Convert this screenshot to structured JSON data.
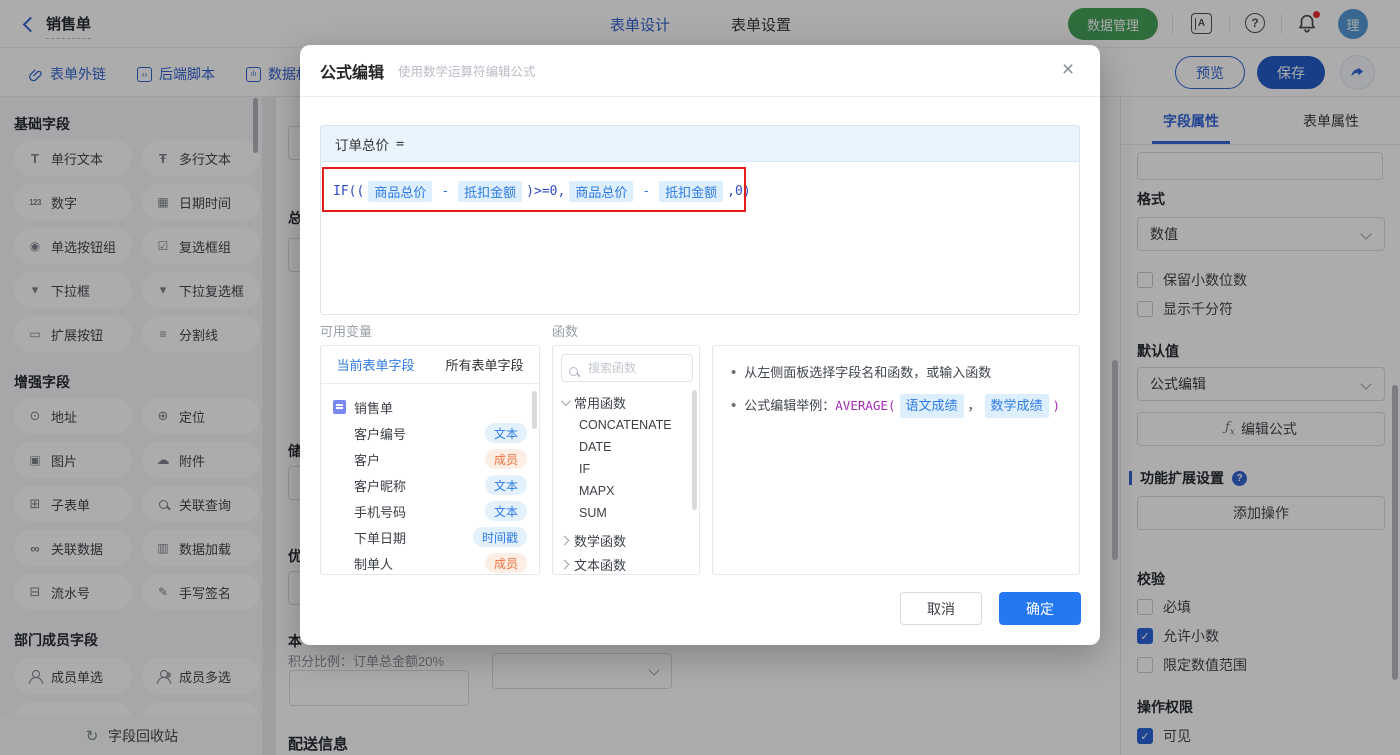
{
  "colors": {
    "primary_blue": "#2e5fd0",
    "accent_blue": "#2e7ae5",
    "confirm_blue": "#2479f2",
    "save_blue": "#1e56c8",
    "green": "#3f9e55",
    "red_annotation": "#e11d1d",
    "chip_bg": "#ddeefc",
    "member_orange": "#f0703a",
    "example_purple": "#a52ab5",
    "avatar_blue": "#4f96d4"
  },
  "topbar": {
    "title": "销售单",
    "tabs": [
      {
        "label": "表单设计",
        "active": true
      },
      {
        "label": "表单设置",
        "active": false
      }
    ],
    "data_manage_button": "数据管理",
    "avatar_text": "理"
  },
  "toolbar": {
    "links": [
      "表单外链",
      "后端脚本",
      "数据权"
    ],
    "preview_button": "预览",
    "save_button": "保存"
  },
  "sidebar": {
    "sections": [
      {
        "title": "基础字段",
        "items": [
          "单行文本",
          "多行文本",
          "数字",
          "日期时间",
          "单选按钮组",
          "复选框组",
          "下拉框",
          "下拉复选框",
          "扩展按钮",
          "分割线"
        ]
      },
      {
        "title": "增强字段",
        "items": [
          "地址",
          "定位",
          "图片",
          "附件",
          "子表单",
          "关联查询",
          "关联数据",
          "数据加载",
          "流水号",
          "手写签名"
        ]
      },
      {
        "title": "部门成员字段",
        "items": [
          "成员单选",
          "成员多选"
        ]
      }
    ],
    "recycle_bin": "字段回收站"
  },
  "canvas": {
    "field_labels": [
      "总",
      "储",
      "优",
      "本"
    ],
    "points_hint": "积分比例：订单总金额20%",
    "section_title": "配送信息"
  },
  "modal": {
    "title": "公式编辑",
    "subtitle": "使用数学运算符编辑公式",
    "target_field": "订单总价",
    "equals_sign": "=",
    "formula": {
      "full_text": "IF(( 商品总价 - 抵扣金额 )>=0, 商品总价 - 抵扣金额 ,0)",
      "code_prefix": "IF((",
      "var1": "商品总价",
      "operator1": "-",
      "var2": "抵扣金额",
      "code_mid": ")>=0,",
      "var3": "商品总价",
      "operator2": "-",
      "var4": "抵扣金额",
      "code_suffix": ",0)"
    },
    "variables": {
      "label": "可用变量",
      "tabs": [
        {
          "label": "当前表单字段",
          "active": true
        },
        {
          "label": "所有表单字段",
          "active": false
        }
      ],
      "form_name": "销售单",
      "fields": [
        {
          "name": "客户编号",
          "type": "文本"
        },
        {
          "name": "客户",
          "type": "成员"
        },
        {
          "name": "客户昵称",
          "type": "文本"
        },
        {
          "name": "手机号码",
          "type": "文本"
        },
        {
          "name": "下单日期",
          "type": "时间戳"
        },
        {
          "name": "制单人",
          "type": "成员"
        }
      ]
    },
    "functions": {
      "label": "函数",
      "search_placeholder": "搜索函数",
      "groups": [
        {
          "name": "常用函数",
          "expanded": true,
          "items": [
            "CONCATENATE",
            "DATE",
            "IF",
            "MAPX",
            "SUM"
          ]
        },
        {
          "name": "数学函数",
          "expanded": false
        },
        {
          "name": "文本函数",
          "expanded": false
        }
      ]
    },
    "help": {
      "line1": "从左侧面板选择字段名和函数，或输入函数",
      "line2_prefix": "公式编辑举例：",
      "function_name": "AVERAGE(",
      "example_var1": "语文成绩",
      "separator": "，",
      "example_var2": "数学成绩",
      "closing": ")"
    },
    "cancel_button": "取消",
    "confirm_button": "确定"
  },
  "right_panel": {
    "tabs": [
      {
        "label": "字段属性",
        "active": true
      },
      {
        "label": "表单属性",
        "active": false
      }
    ],
    "format": {
      "label": "格式",
      "value": "数值"
    },
    "format_checks": [
      {
        "label": "保留小数位数",
        "checked": false
      },
      {
        "label": "显示千分符",
        "checked": false
      }
    ],
    "default_value": {
      "label": "默认值",
      "value": "公式编辑",
      "fx_button": "编辑公式"
    },
    "extension": {
      "title": "功能扩展设置",
      "add_button": "添加操作"
    },
    "validation": {
      "title": "校验",
      "checks": [
        {
          "label": "必填",
          "checked": false
        },
        {
          "label": "允许小数",
          "checked": true
        },
        {
          "label": "限定数值范围",
          "checked": false
        }
      ]
    },
    "permission": {
      "title": "操作权限",
      "checks": [
        {
          "label": "可见",
          "checked": true
        }
      ]
    }
  }
}
